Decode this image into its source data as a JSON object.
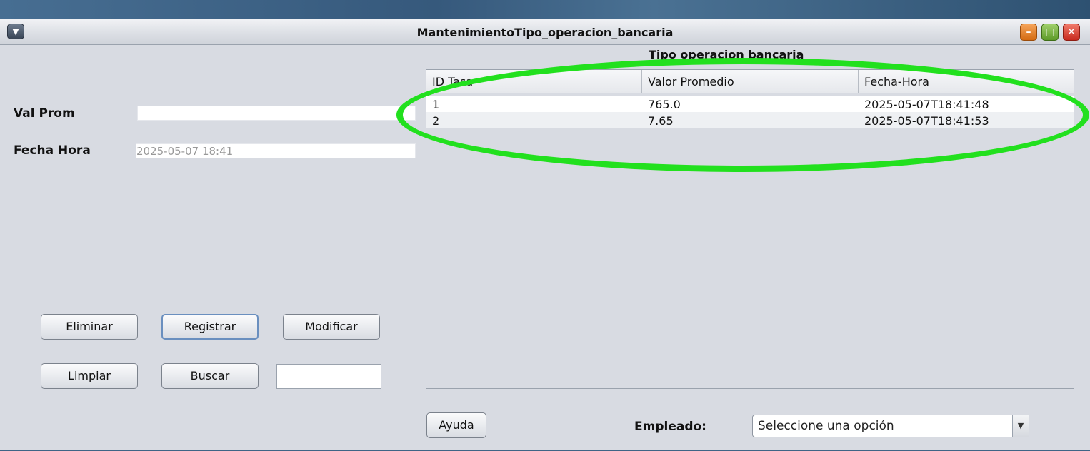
{
  "window": {
    "title": "MantenimientoTipo_operacion_bancaria"
  },
  "form": {
    "val_prom_label": "Val Prom",
    "val_prom_value": "",
    "fecha_hora_label": "Fecha Hora",
    "fecha_hora_value": "2025-05-07 18:41"
  },
  "buttons": {
    "eliminar": "Eliminar",
    "registrar": "Registrar",
    "modificar": "Modificar",
    "limpiar": "Limpiar",
    "buscar": "Buscar",
    "ayuda": "Ayuda"
  },
  "search": {
    "value": ""
  },
  "table": {
    "title": "Tipo operacion bancaria",
    "columns": [
      "ID Tasa",
      "Valor Promedio",
      "Fecha-Hora"
    ],
    "rows": [
      [
        "1",
        "765.0",
        "2025-05-07T18:41:48"
      ],
      [
        "2",
        "7.65",
        "2025-05-07T18:41:53"
      ]
    ]
  },
  "empleado": {
    "label": "Empleado:",
    "selected": "Seleccione una opción"
  },
  "annotation": {
    "color": "#22e01e",
    "shape": "ellipse"
  }
}
